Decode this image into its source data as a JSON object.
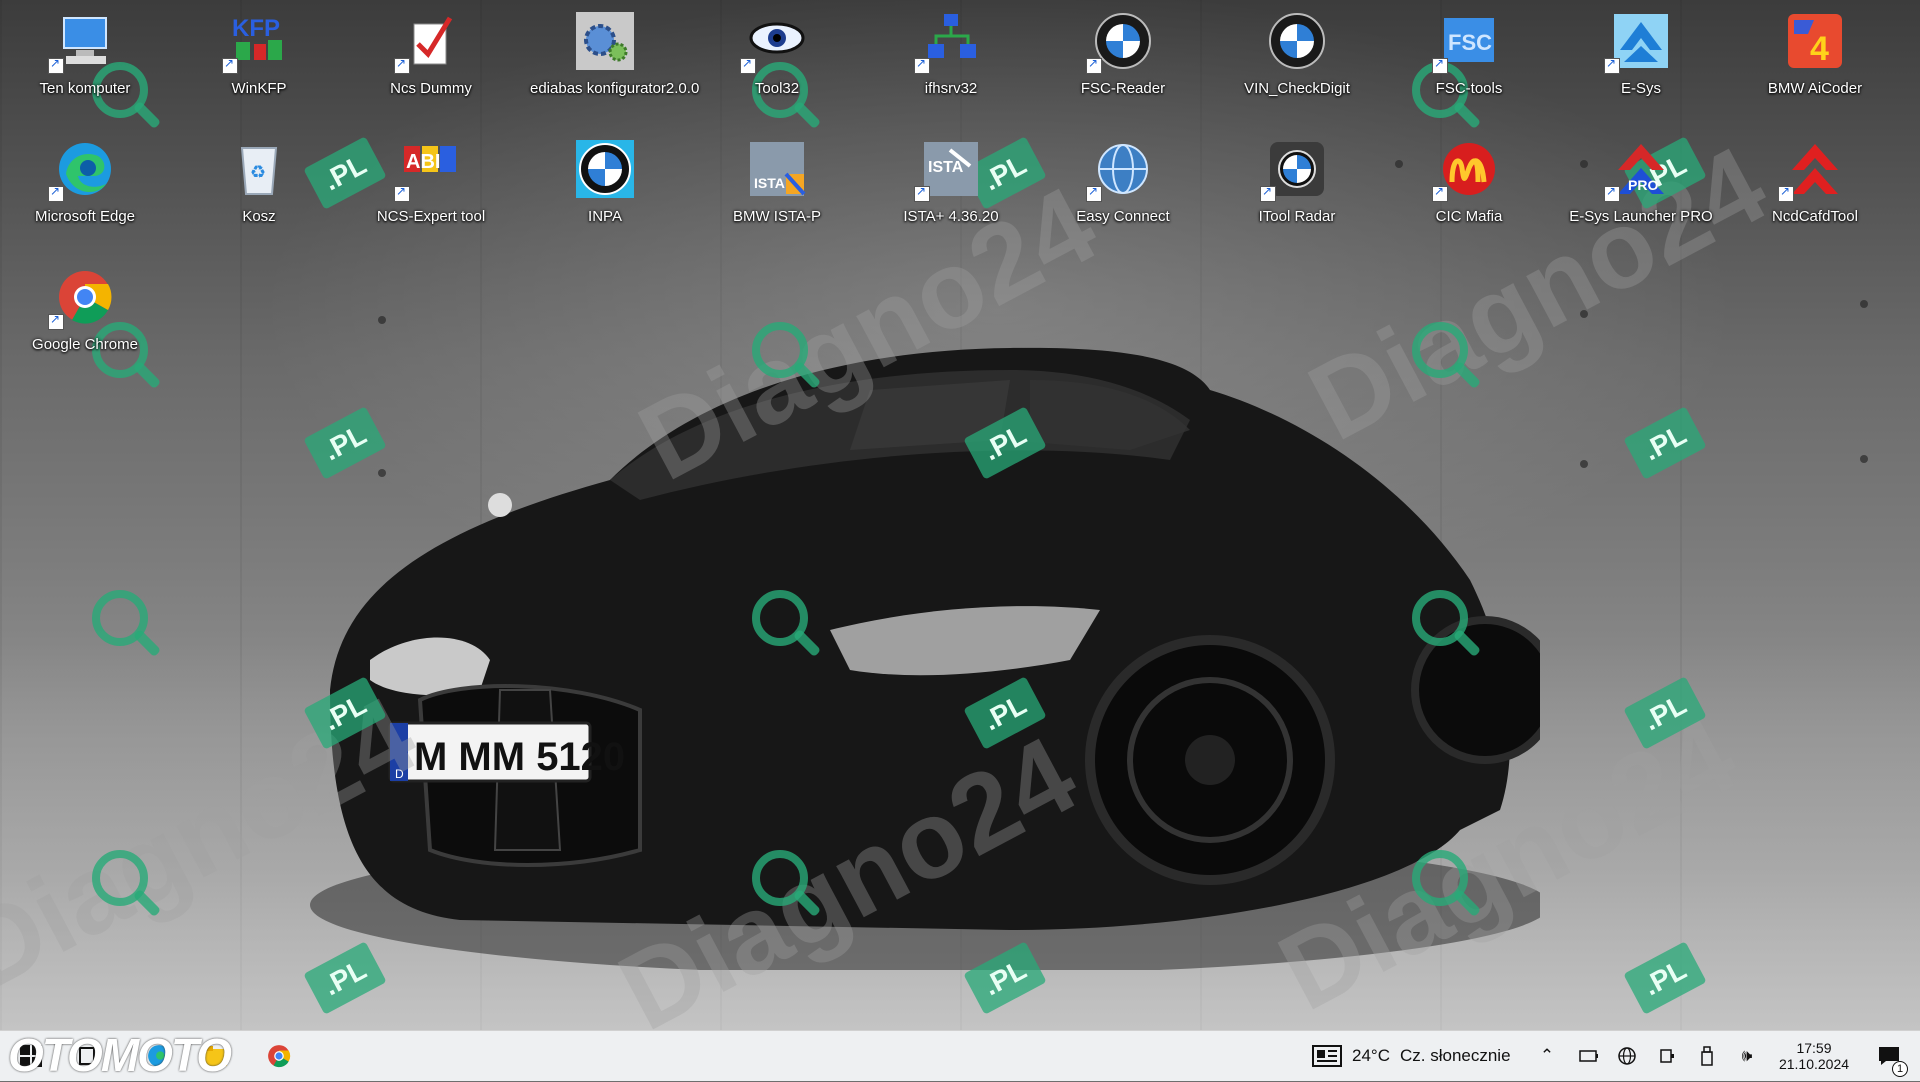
{
  "desktop": {
    "icons": [
      {
        "label": "Ten komputer",
        "icon": "computer-icon"
      },
      {
        "label": "WinKFP",
        "icon": "winkfp-icon"
      },
      {
        "label": "Ncs Dummy",
        "icon": "checkmark-document-icon"
      },
      {
        "label": "ediabas konfigurator2.0.0",
        "icon": "gears-icon"
      },
      {
        "label": "Tool32",
        "icon": "eye-icon"
      },
      {
        "label": "ifhsrv32",
        "icon": "network-icon"
      },
      {
        "label": "FSC-Reader",
        "icon": "bmw-logo-icon"
      },
      {
        "label": "VIN_CheckDigit",
        "icon": "bmw-logo-icon"
      },
      {
        "label": "FSC-tools",
        "icon": "fsc-icon"
      },
      {
        "label": "E-Sys",
        "icon": "esys-icon"
      },
      {
        "label": "BMW AiCoder",
        "icon": "aicoder-icon"
      },
      {
        "label": "Microsoft Edge",
        "icon": "edge-icon"
      },
      {
        "label": "Kosz",
        "icon": "recycle-bin-icon"
      },
      {
        "label": "NCS-Expert tool",
        "icon": "ncs-expert-icon"
      },
      {
        "label": "INPA",
        "icon": "bmw-logo-icon"
      },
      {
        "label": "BMW ISTA-P",
        "icon": "ista-p-icon"
      },
      {
        "label": "ISTA+ 4.36.20",
        "icon": "ista-icon"
      },
      {
        "label": "Easy Connect",
        "icon": "globe-icon"
      },
      {
        "label": "ITool Radar",
        "icon": "itool-radar-icon"
      },
      {
        "label": "CIC Mafia",
        "icon": "mcdonalds-icon"
      },
      {
        "label": "E-Sys Launcher PRO",
        "icon": "esys-launcher-icon"
      },
      {
        "label": "NcdCafdTool",
        "icon": "ncdcafd-icon"
      },
      {
        "label": "Google Chrome",
        "icon": "chrome-icon"
      }
    ]
  },
  "watermark": {
    "brand": "Diagno24",
    "badge": ".PL",
    "overlay": "OTOMOTO"
  },
  "car": {
    "plate": "M MM 5120",
    "plate_country": "D"
  },
  "taskbar": {
    "weather_temp": "24°C",
    "weather_desc": "Cz. słonecznie",
    "time": "17:59",
    "date": "21.10.2024",
    "notification_count": "1"
  },
  "colors": {
    "taskbar_bg": "#eef0f2",
    "watermark_green": "#28aa78",
    "icon_label": "#ffffff"
  }
}
